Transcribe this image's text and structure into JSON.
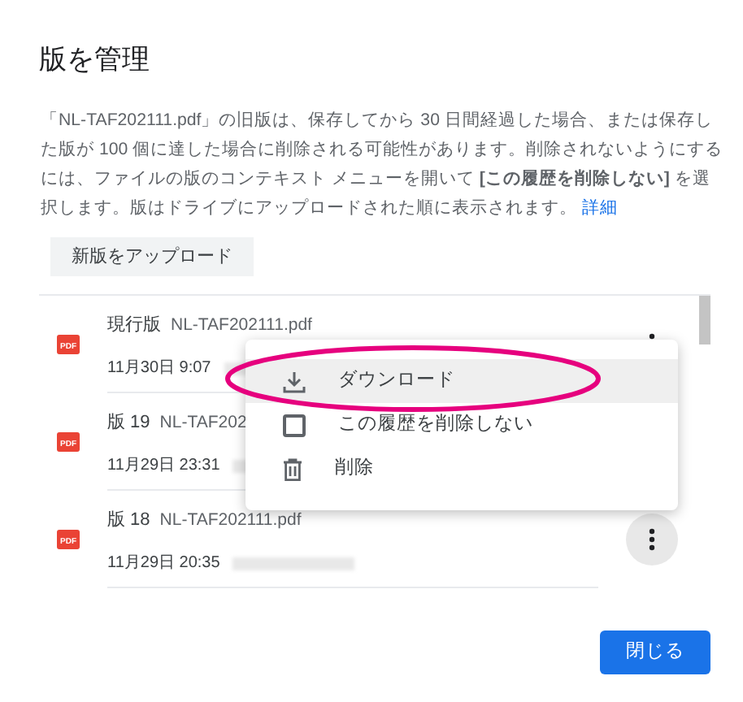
{
  "dialog": {
    "title": "版を管理",
    "description": {
      "text": "「NL-TAF202111.pdf」の旧版は、保存してから 30 日間経過した場合、または保存した版が 100 個に達した場合に削除される可能性があります。削除されないようにするには、ファイルの版のコンテキスト メニューを開いて **[この履歴を削除しない]** を選択します。版はドライブにアップロードされた順に表示されます。",
      "link": "詳細"
    },
    "upload_button": "新版をアップロード",
    "versions": [
      {
        "icon_label": "PDF",
        "version": "現行版",
        "filename": "NL-TAF202111.pdf",
        "date": "11月30日 9:07",
        "menu_open": false
      },
      {
        "icon_label": "PDF",
        "version": "版 19",
        "filename": "NL-TAF202",
        "date": "11月29日 23:31",
        "menu_open": false
      },
      {
        "icon_label": "PDF",
        "version": "版 18",
        "filename": "NL-TAF202111.pdf",
        "date": "11月29日 20:35",
        "menu_open": true
      }
    ],
    "context_menu": [
      {
        "kind": "download",
        "label": "ダウンロード",
        "highlighted": true
      },
      {
        "kind": "checkbox",
        "label": "この履歴を削除しない",
        "checked": false,
        "highlighted": false
      },
      {
        "kind": "delete",
        "label": "削除",
        "highlighted": false
      }
    ],
    "close_button": "閉じる"
  }
}
